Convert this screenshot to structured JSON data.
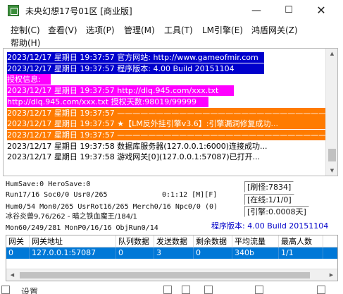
{
  "window": {
    "title": "未央幻想17号01区 [商业版]",
    "minimize": "—",
    "maximize": "☐",
    "close": "✕"
  },
  "menu": {
    "items": [
      "控制(C)",
      "查看(V)",
      "选项(P)",
      "管理(M)",
      "工具(T)",
      "LM引擎(E)",
      "鸿盾网关(Z)",
      "帮助(H)"
    ]
  },
  "log": {
    "lines": [
      {
        "text": "2023/12/17 星期日 19:37:57 官方网站: http://www.gameofmir.com",
        "bg": "#0000cc",
        "color": "#ffffff"
      },
      {
        "text": "2023/12/17 星期日 19:37:57 程序版本: 4.00 Build 20151104",
        "bg": "#0000cc",
        "color": "#ffffff"
      },
      {
        "text": "授权信息:",
        "bg": "#ff00ff",
        "color": "#ffffff"
      },
      {
        "text": "2023/12/17 星期日 19:37:57 http://dlq.945.com/xxx.txt",
        "bg": "#ff00ff",
        "color": "#ffffff"
      },
      {
        "text": "http://dlq.945.com/xxx.txt 授权天数:98019/99999",
        "bg": "#ff00ff",
        "color": "#ffffff"
      },
      {
        "text": "2023/12/17 星期日 19:37:57 ——————————————————————————————",
        "bg": "#ff7b00",
        "color": "#ffffff"
      },
      {
        "text": "2023/12/17 星期日 19:37:57 ★【LM反外挂引擎v3.6】:引擎漏洞修复成功...",
        "bg": "#ff7b00",
        "color": "#ffffff"
      },
      {
        "text": "2023/12/17 星期日 19:37:57 ——————————————————————————————",
        "bg": "#ff7b00",
        "color": "#ffffff"
      },
      {
        "text": "2023/12/17 星期日 19:37:58 数据库服务器(127.0.0.1:6000)连接成功...",
        "bg": "#ffffff",
        "color": "#000000"
      },
      {
        "text": "2023/12/17 星期日 19:37:58 游戏网关[0](127.0.0.1:57087)已打开...",
        "bg": "#ffffff",
        "color": "#000000"
      }
    ]
  },
  "status": {
    "row1": "HumSave:0 HeroSave:0",
    "row2": "Run17/16 Soc0/0 Usr0/265",
    "row2_time": "0:1:12 [M][F]",
    "row3": "Hum0/54 Mon0/265 UsrRot16/265 Merch0/16 Npc0/0 (0)",
    "row4": "冰谷炎兽9,76/262 - 暗之铁血魔王/184/1",
    "row5": "Mon60/249/281 MonP0/16/16 ObjRun0/14",
    "refresh": "[刷怪:7834]",
    "online": "[在线:1/1/0]",
    "engine": "[引擎:0.0008天]",
    "version": "程序版本: 4.00 Build 20151104"
  },
  "grid": {
    "columns": [
      "网关",
      "网关地址",
      "队列数据",
      "发送数据",
      "剩余数据",
      "平均流量",
      "最高人数"
    ],
    "rows": [
      [
        "0",
        "127.0.0.1:57087",
        "0",
        "3",
        "0",
        "340b",
        "1/1"
      ]
    ]
  },
  "bottom": {
    "label": "设置"
  },
  "colors": {
    "selection": "#0078d7",
    "version_text": "#0000c8",
    "log_blue": "#0000cc",
    "log_magenta": "#ff00ff",
    "log_orange": "#ff7b00"
  }
}
